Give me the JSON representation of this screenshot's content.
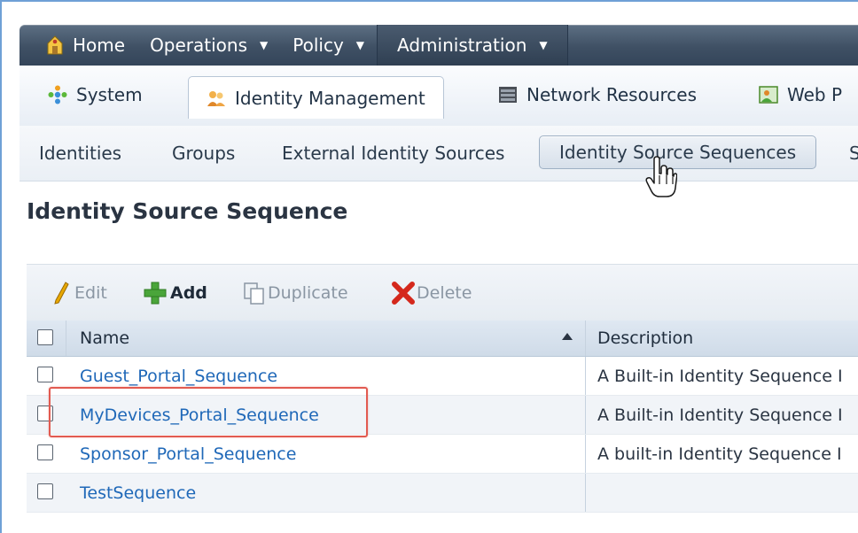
{
  "top_nav": {
    "items": [
      {
        "label": "Home",
        "icon": "home-icon",
        "has_caret": false
      },
      {
        "label": "Operations",
        "icon": null,
        "has_caret": true
      },
      {
        "label": "Policy",
        "icon": null,
        "has_caret": true
      },
      {
        "label": "Administration",
        "icon": null,
        "has_caret": true,
        "active": true
      }
    ],
    "caret": "▼"
  },
  "sub_nav": {
    "tabs": [
      {
        "label": "System",
        "icon": "system-icon"
      },
      {
        "label": "Identity Management",
        "icon": "identity-management-icon",
        "selected": true
      },
      {
        "label": "Network Resources",
        "icon": "network-resources-icon"
      },
      {
        "label": "Web P",
        "icon": "web-portal-icon"
      }
    ]
  },
  "third_nav": {
    "links": [
      {
        "label": "Identities"
      },
      {
        "label": "Groups"
      },
      {
        "label": "External Identity Sources"
      },
      {
        "label": "Identity Source Sequences",
        "selected": true
      },
      {
        "label": "S"
      }
    ]
  },
  "page": {
    "title": "Identity Source Sequence"
  },
  "toolbar": {
    "edit_label": "Edit",
    "add_label": "Add",
    "duplicate_label": "Duplicate",
    "delete_label": "Delete"
  },
  "table": {
    "columns": [
      "Name",
      "Description"
    ],
    "rows": [
      {
        "name": "Guest_Portal_Sequence",
        "description": "A Built-in Identity Sequence I"
      },
      {
        "name": "MyDevices_Portal_Sequence",
        "description": "A Built-in Identity Sequence I",
        "highlighted": true
      },
      {
        "name": "Sponsor_Portal_Sequence",
        "description": "A built-in Identity Sequence I"
      },
      {
        "name": "TestSequence",
        "description": ""
      }
    ]
  },
  "colors": {
    "link": "#1f68b8",
    "highlight": "#e25a50",
    "nav_dark": "#3f5064",
    "add_green": "#4aa53a",
    "delete_red": "#d4281c",
    "edit_yellow": "#e8a800"
  }
}
